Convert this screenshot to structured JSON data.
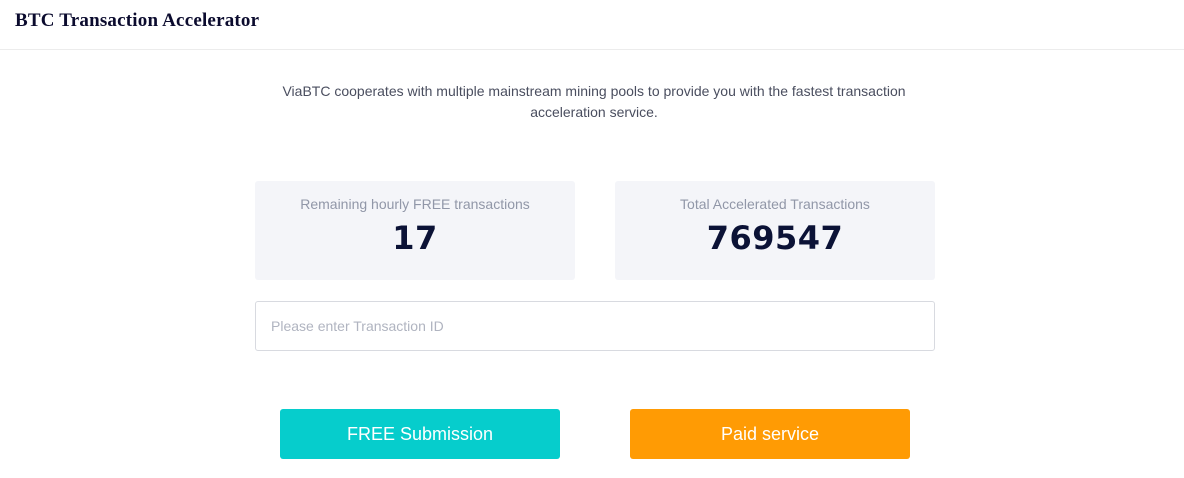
{
  "header": {
    "title": "BTC Transaction Accelerator"
  },
  "intro": {
    "text": "ViaBTC cooperates with multiple mainstream mining pools to provide you with the fastest transaction acceleration service."
  },
  "stats": {
    "free_remaining": {
      "label": "Remaining hourly FREE transactions",
      "value": "17"
    },
    "total_accelerated": {
      "label": "Total Accelerated Transactions",
      "value": "769547"
    }
  },
  "form": {
    "txid_placeholder": "Please enter Transaction ID",
    "txid_value": ""
  },
  "actions": {
    "free_label": "FREE Submission",
    "paid_label": "Paid service"
  },
  "colors": {
    "free_button": "#06cdcc",
    "paid_button": "#ff9b04",
    "card_background": "#f4f5f9"
  }
}
